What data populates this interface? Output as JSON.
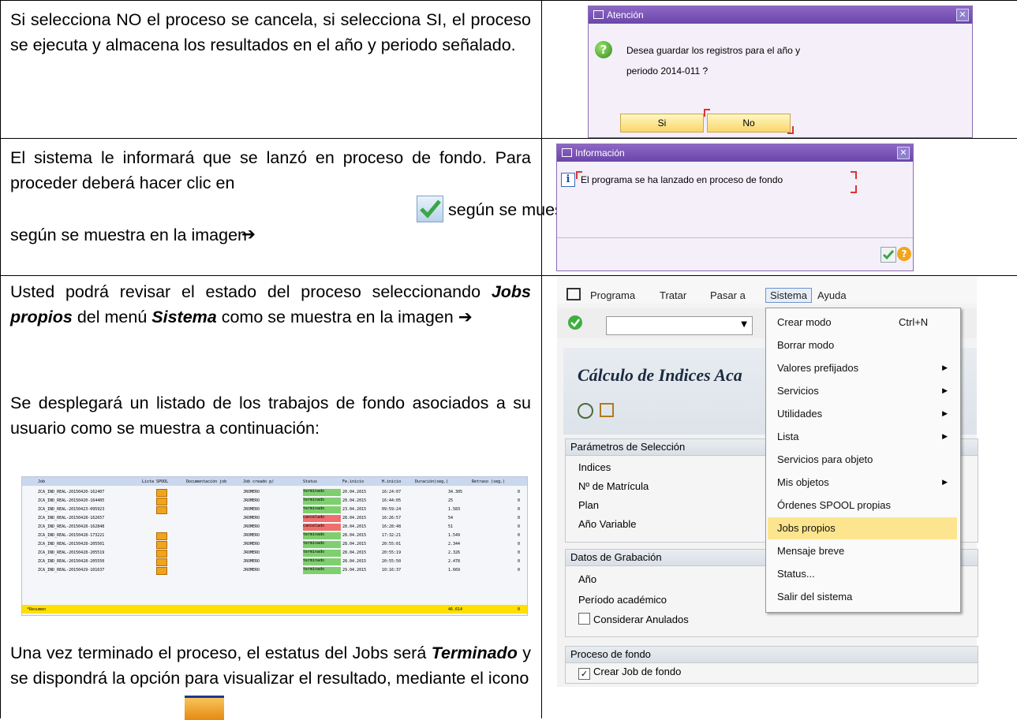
{
  "rows": [
    {
      "text": "Si selecciona NO el proceso se cancela, si selecciona SI, el proceso se ejecuta y almacena los resultados en el año y periodo señalado."
    },
    {
      "text_before_icon": "El sistema le informará que se lanzó en proceso de fondo. Para proceder deberá hacer clic en",
      "text_after_icon": "según se muestra en la imagen",
      "arrow": "➔"
    },
    {
      "para1_a": "Usted podrá revisar el estado del proceso seleccionando",
      "para1_b": "Jobs propios",
      "para1_c": "del menú",
      "para1_d": "Sistema",
      "para1_e": "como se muestra en la imagen",
      "arrow": "➔",
      "para2": "Se desplegará un listado de los trabajos de fondo asociados a su usuario como se muestra a continuación:",
      "para3_a": "Una vez terminado el proceso, el estatus del Jobs será",
      "para3_b": "Terminado",
      "para3_c": "y se dispondrá  la opción para visualizar el resultado, mediante el icono"
    }
  ],
  "dialog_attention": {
    "title": "Atención",
    "message_line1": "Desea guardar los registros para el año y",
    "message_line2": "periodo 2014-011 ?",
    "yes_label": "Si",
    "no_label": "No"
  },
  "dialog_info": {
    "title": "Información",
    "message": "El programa se ha lanzado en proceso de fondo"
  },
  "sap_screen": {
    "menu": [
      "Programa",
      "Tratar",
      "Pasar a",
      "Sistema",
      "Ayuda"
    ],
    "title": "Cálculo de Indices Aca",
    "group1_title": "Parámetros de Selección",
    "group1_fields": [
      "Indices",
      "Nº de Matrícula",
      "Plan",
      "Año Variable"
    ],
    "group2_title": "Datos de Grabación",
    "group2_fields": [
      "Año",
      "Período académico"
    ],
    "group2_checkbox": "Considerar Anulados",
    "group3_title": "Proceso de fondo",
    "group3_checkbox": "Crear Job de fondo",
    "dropdown": [
      {
        "label": "Crear modo",
        "shortcut": "Ctrl+N",
        "submenu": false
      },
      {
        "label": "Borrar modo",
        "shortcut": "",
        "submenu": false
      },
      {
        "label": "Valores prefijados",
        "shortcut": "",
        "submenu": true
      },
      {
        "label": "Servicios",
        "shortcut": "",
        "submenu": true
      },
      {
        "label": "Utilidades",
        "shortcut": "",
        "submenu": true
      },
      {
        "label": "Lista",
        "shortcut": "",
        "submenu": true
      },
      {
        "label": "Servicios para objeto",
        "shortcut": "",
        "submenu": false
      },
      {
        "label": "Mis objetos",
        "shortcut": "",
        "submenu": true
      },
      {
        "label": "Órdenes SPOOL propias",
        "shortcut": "",
        "submenu": false
      },
      {
        "label": "Jobs propios",
        "shortcut": "",
        "submenu": false,
        "highlighted": true
      },
      {
        "label": "Mensaje breve",
        "shortcut": "",
        "submenu": false
      },
      {
        "label": "Status...",
        "shortcut": "",
        "submenu": false
      },
      {
        "label": "Salir del sistema",
        "shortcut": "",
        "submenu": false
      }
    ]
  },
  "jobs_table": {
    "headers": [
      "Job",
      "Lista SPOOL",
      "Documentación job",
      "Job creado p/",
      "Status",
      "Fe.inicio",
      "H.inicio",
      "Duración(seg.)",
      "Retraso (seg.)"
    ],
    "rows": [
      {
        "job": "ZCA_IND_REAL-20150420-162407",
        "spool": true,
        "user": "JROMERO",
        "status": "terminado",
        "date": "20.04.2015",
        "time": "16:24:07",
        "dur": "34.305",
        "delay": "0"
      },
      {
        "job": "ZCA_IND_REAL-20150420-164405",
        "spool": true,
        "user": "JROMERO",
        "status": "terminado",
        "date": "20.04.2015",
        "time": "16:44:05",
        "dur": "25",
        "delay": "0"
      },
      {
        "job": "ZCA_IND_REAL-20150423-095923",
        "spool": true,
        "user": "JROMERO",
        "status": "terminado",
        "date": "23.04.2015",
        "time": "09:59:24",
        "dur": "1.583",
        "delay": "0"
      },
      {
        "job": "ZCA_IND_REAL-20150428-162657",
        "spool": false,
        "user": "JROMERO",
        "status": "cancelado",
        "date": "28.04.2015",
        "time": "16:26:57",
        "dur": "54",
        "delay": "0"
      },
      {
        "job": "ZCA_IND_REAL-20150428-162848",
        "spool": false,
        "user": "JROMERO",
        "status": "cancelado",
        "date": "28.04.2015",
        "time": "16:28:48",
        "dur": "51",
        "delay": "0"
      },
      {
        "job": "ZCA_IND_REAL-20150428-173221",
        "spool": true,
        "user": "JROMERO",
        "status": "terminado",
        "date": "28.04.2015",
        "time": "17:32:21",
        "dur": "1.549",
        "delay": "0"
      },
      {
        "job": "ZCA_IND_REAL-20150428-205501",
        "spool": true,
        "user": "JROMERO",
        "status": "terminado",
        "date": "28.04.2015",
        "time": "20:55:01",
        "dur": "2.344",
        "delay": "0"
      },
      {
        "job": "ZCA_IND_REAL-20150428-205519",
        "spool": true,
        "user": "JROMERO",
        "status": "terminado",
        "date": "28.04.2015",
        "time": "20:55:19",
        "dur": "2.326",
        "delay": "0"
      },
      {
        "job": "ZCA_IND_REAL-20150428-205550",
        "spool": true,
        "user": "JROMERO",
        "status": "terminado",
        "date": "28.04.2015",
        "time": "20:55:50",
        "dur": "2.478",
        "delay": "0"
      },
      {
        "job": "ZCA_IND_REAL-20150429-101637",
        "spool": true,
        "user": "JROMERO",
        "status": "terminado",
        "date": "29.04.2015",
        "time": "10:16:37",
        "dur": "1.669",
        "delay": "0"
      }
    ],
    "summary_label": "*Resumen",
    "summary_total": "46.614",
    "summary_delay": "0"
  }
}
